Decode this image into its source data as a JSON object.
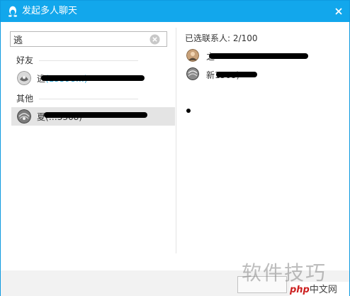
{
  "window": {
    "title": "发起多人聊天"
  },
  "search": {
    "value": "逃"
  },
  "groups": {
    "friends": {
      "label": "好友",
      "contacts": [
        {
          "name": "逃",
          "suffix": "(13598…)"
        }
      ]
    },
    "others": {
      "label": "其他",
      "contacts": [
        {
          "name": "夏",
          "suffix": "(…3368)"
        }
      ]
    }
  },
  "selected": {
    "label": "已选联系人:",
    "count": "2/100",
    "contacts": [
      {
        "name": "之",
        "suffix": ""
      },
      {
        "name": "新",
        "suffix": "1568)"
      }
    ]
  },
  "watermark": {
    "text": "软件技巧",
    "badge_php": "php",
    "badge_rest": "中文网"
  },
  "colors": {
    "titlebar": "#12a7ec",
    "selected_row": "#e4e4e4"
  }
}
